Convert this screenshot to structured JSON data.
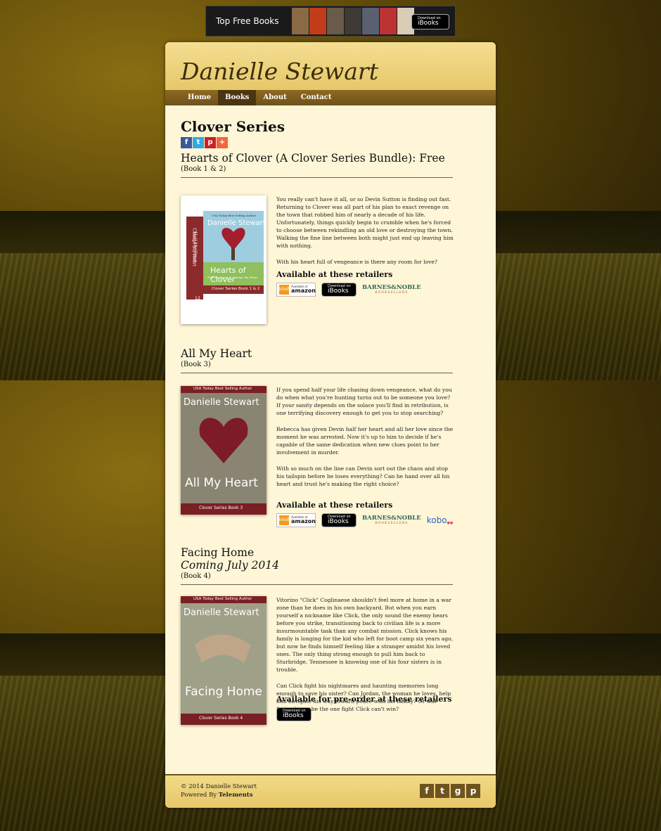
{
  "banner": {
    "title": "Top Free Books",
    "ibooks_small": "Download on",
    "ibooks_big": "iBooks"
  },
  "site": {
    "title": "Danielle Stewart",
    "nav": [
      "Home",
      "Books",
      "About",
      "Contact"
    ],
    "nav_active": "Books"
  },
  "series": {
    "title": "Clover Series",
    "share": [
      "f",
      "t",
      "p",
      "+"
    ]
  },
  "books": [
    {
      "title": "Hearts of Clover (A Clover Series Bundle): Free",
      "number": "(Book 1 & 2)",
      "description": [
        "You really can't have it all, or so Devin Sutton is finding out fast. Returning to Clover was all part of his plan to exact revenge on the town that robbed him of nearly a decade of his life. Unfortunately, things quickly begin to crumble when he's forced to choose between rekindling an old love or destroying the town. Walking the fine line between both might just end up leaving him with nothing.",
        "With his heart full of vengeance is there any room for love?"
      ],
      "retail_heading": "Available at these retailers",
      "cover": {
        "top": "USA Today Best Selling Author",
        "author": "Danielle Stewart",
        "title": "Hearts of Clover",
        "subtitle": "Half My Heart & Change My Heart",
        "bottom": "Clover Series Book 1 & 2",
        "spine": "Change My Heart",
        "spine2": "Half My Heart"
      }
    },
    {
      "title": "All My Heart",
      "number": "(Book 3)",
      "description": [
        "If you spend half your life chasing down vengeance, what do you do when what you're hunting turns out to be someone you love? If your sanity depends on the solace you'll find in retribution, is one terrifying discovery enough to get you to stop searching?",
        "Rebecca has given Devin half her heart and all her love since the moment he was arrested. Now it's up to him to decide if he's capable of the same dedication when new clues point to her involvement in murder.",
        "With so much on the line can Devin sort out the chaos and stop his tailspin before he loses everything? Can he hand over all his heart and trust he's making the right choice?"
      ],
      "retail_heading": "Available at these retailers",
      "cover": {
        "top": "USA Today Best Selling Author",
        "author": "Danielle Stewart",
        "title": "All My Heart",
        "bottom": "Clover Series Book 3"
      }
    },
    {
      "title": "Facing Home",
      "subtitle": "Coming July 2014",
      "number": "(Book 4)",
      "description": [
        "Vitorino \"Click\" Coglinaese shouldn't feel more at home in a war zone than he does in his own backyard. But when you earn yourself a nickname like Click, the only sound the enemy hears before you strike, transitioning back to civilian life is a more insurmountable task than any combat mission. Click knows his family is longing for the kid who left for boot camp six years ago, but now he finds himself feeling like a stranger amidst his loved ones. The only thing strong enough to pull him back to Sturbridge, Tennessee is knowing one of his four sisters is in trouble.",
        "Can Click fight his nightmares and haunting memories long enough to save his sister? Can Jordan, the woman he loves, help him navigate his way toward peace with his family? Or will facing home be the one fight Click can't win?"
      ],
      "retail_heading": "Available for pre-order at these retailers",
      "cover": {
        "top": "USA Today Best Selling Author",
        "author": "Danielle Stewart",
        "title": "Facing Home",
        "bottom": "Clover Series Book 4"
      }
    }
  ],
  "retailers": {
    "amazon_small": "Available at",
    "amazon": "amazon",
    "amazon_icon": "kindle",
    "ibooks_small": "Download on",
    "ibooks": "iBooks",
    "bn_top": "BARNES&NOBLE",
    "bn_bottom": "BOOKSELLERS",
    "kobo": "kobo"
  },
  "footer": {
    "copyright": "© 2014 Danielle Stewart",
    "powered_prefix": "Powered By",
    "powered_by": "Telements",
    "social": [
      "f",
      "t",
      "g",
      "p"
    ]
  }
}
